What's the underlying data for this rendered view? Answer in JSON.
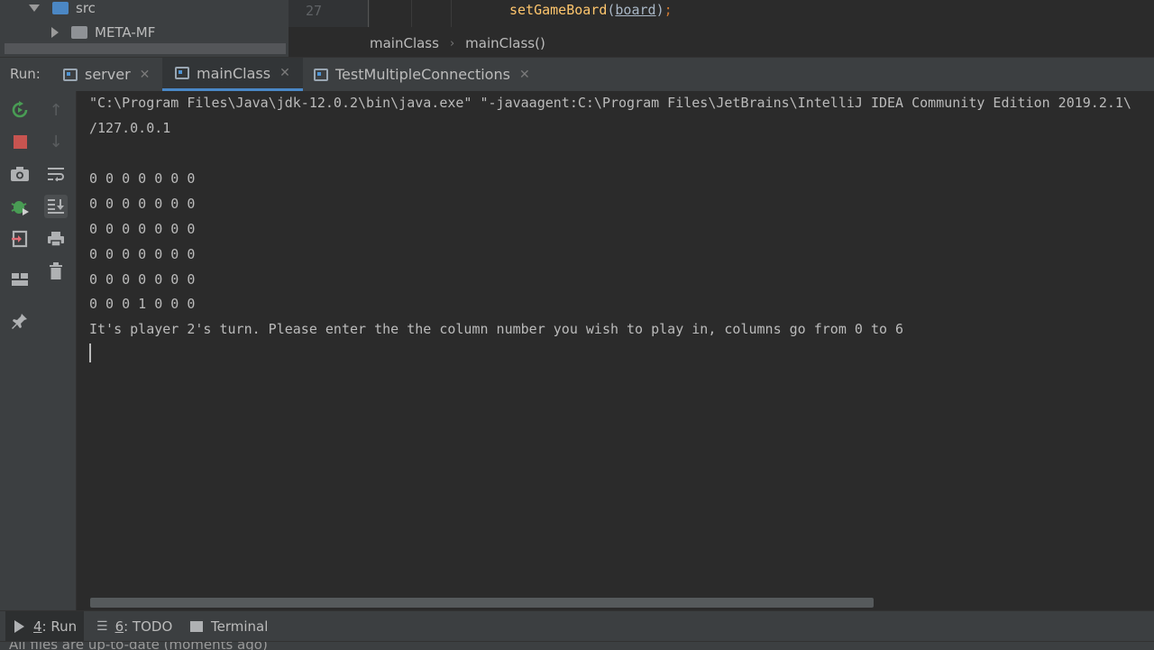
{
  "project_tree": {
    "items": [
      {
        "label": "src"
      },
      {
        "label": "META-MF"
      }
    ]
  },
  "editor": {
    "line_number": "27",
    "code": {
      "fn": "setGameBoard",
      "open": "(",
      "arg": "board",
      "close": ")",
      "semi": ";"
    },
    "breadcrumb": [
      "mainClass",
      "mainClass()"
    ]
  },
  "run_window": {
    "label": "Run:",
    "tabs": [
      {
        "label": "server"
      },
      {
        "label": "mainClass"
      },
      {
        "label": "TestMultipleConnections"
      }
    ]
  },
  "console": {
    "lines": [
      "\"C:\\Program Files\\Java\\jdk-12.0.2\\bin\\java.exe\" \"-javaagent:C:\\Program Files\\JetBrains\\IntelliJ IDEA Community Edition 2019.2.1\\",
      "/127.0.0.1",
      "",
      "0 0 0 0 0 0 0",
      "0 0 0 0 0 0 0",
      "0 0 0 0 0 0 0",
      "0 0 0 0 0 0 0",
      "0 0 0 0 0 0 0",
      "0 0 0 1 0 0 0",
      "It's player 2's turn. Please enter the the column number you wish to play in, columns go from 0 to 6"
    ]
  },
  "bottom_tabs": [
    {
      "num": "4",
      "label": ": Run"
    },
    {
      "num": "6",
      "label": ": TODO"
    },
    {
      "num": "",
      "label": "Terminal"
    }
  ],
  "status": "All files are up-to-date (moments ago)",
  "colors": {
    "accent": "#4a88c7",
    "stop": "#c75450",
    "rerun": "#499c54"
  }
}
